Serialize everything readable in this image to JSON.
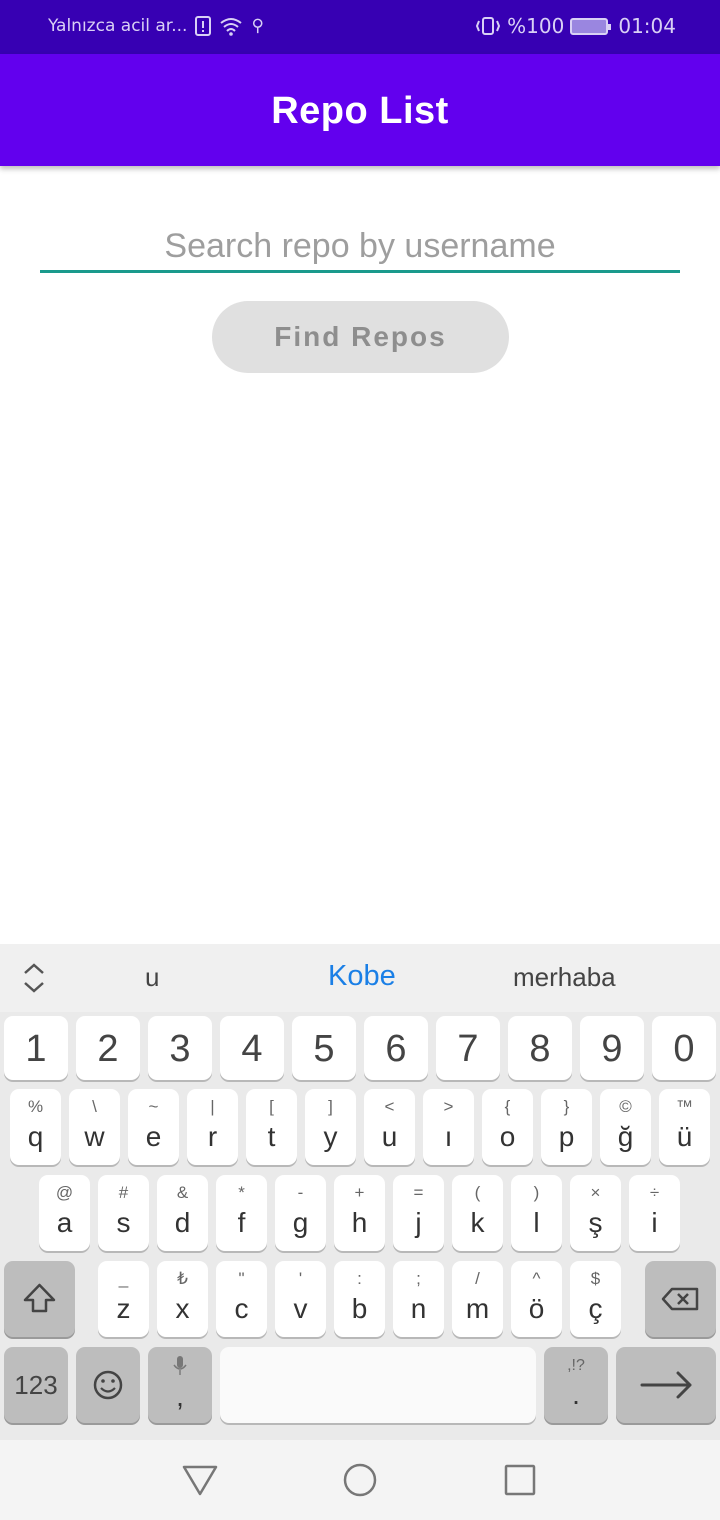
{
  "status_bar": {
    "carrier_text": "Yalnızca acil ar...",
    "battery_percent": "%100",
    "time": "01:04"
  },
  "app_bar": {
    "title": "Repo List"
  },
  "search": {
    "placeholder": "Search repo by username",
    "value": ""
  },
  "find_button": {
    "label": "Find Repos"
  },
  "keyboard": {
    "suggestions": [
      "u",
      "Kobe",
      "merhaba"
    ],
    "number_row": [
      "1",
      "2",
      "3",
      "4",
      "5",
      "6",
      "7",
      "8",
      "9",
      "0"
    ],
    "row1": [
      {
        "main": "q",
        "sec": "%"
      },
      {
        "main": "w",
        "sec": "\\"
      },
      {
        "main": "e",
        "sec": "~"
      },
      {
        "main": "r",
        "sec": "|"
      },
      {
        "main": "t",
        "sec": "["
      },
      {
        "main": "y",
        "sec": "]"
      },
      {
        "main": "u",
        "sec": "<"
      },
      {
        "main": "ı",
        "sec": ">"
      },
      {
        "main": "o",
        "sec": "{"
      },
      {
        "main": "p",
        "sec": "}"
      },
      {
        "main": "ğ",
        "sec": "©"
      },
      {
        "main": "ü",
        "sec": "™"
      }
    ],
    "row2": [
      {
        "main": "a",
        "sec": "@"
      },
      {
        "main": "s",
        "sec": "#"
      },
      {
        "main": "d",
        "sec": "&"
      },
      {
        "main": "f",
        "sec": "*"
      },
      {
        "main": "g",
        "sec": "-"
      },
      {
        "main": "h",
        "sec": "+"
      },
      {
        "main": "j",
        "sec": "="
      },
      {
        "main": "k",
        "sec": "("
      },
      {
        "main": "l",
        "sec": ")"
      },
      {
        "main": "ş",
        "sec": "×"
      },
      {
        "main": "i",
        "sec": "÷"
      }
    ],
    "row3": [
      {
        "main": "z",
        "sec": "_"
      },
      {
        "main": "x",
        "sec": "₺"
      },
      {
        "main": "c",
        "sec": "\""
      },
      {
        "main": "v",
        "sec": "'"
      },
      {
        "main": "b",
        "sec": ":"
      },
      {
        "main": "n",
        "sec": ";"
      },
      {
        "main": "m",
        "sec": "/"
      },
      {
        "main": "ö",
        "sec": "^"
      },
      {
        "main": "ç",
        "sec": "$"
      }
    ],
    "numbers_switch_label": "123",
    "comma_label": ",",
    "period_label": ".",
    "period_sec": ",!?"
  },
  "icons": {
    "shift": "shift-icon",
    "backspace": "backspace-icon",
    "emoji": "emoji-icon",
    "mic": "mic-icon",
    "enter": "enter-arrow-icon",
    "nav_back": "back-triangle-icon",
    "nav_home": "home-circle-icon",
    "nav_recents": "recents-square-icon"
  },
  "colors": {
    "status_bar": "#3700b3",
    "app_bar": "#6200ee",
    "field_underline": "#1a9a8c",
    "suggestion_highlight": "#1a7fe6"
  }
}
